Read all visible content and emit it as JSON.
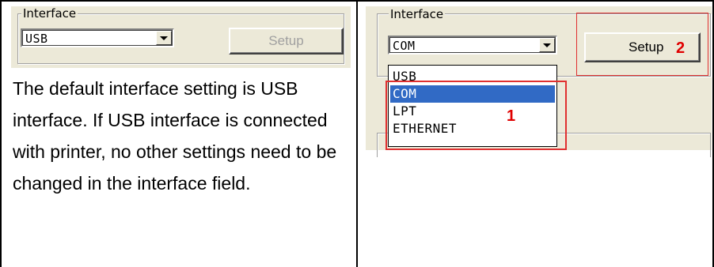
{
  "left": {
    "group_label": "Interface",
    "combo_value": "USB",
    "setup_label": "Setup",
    "description": "The default interface setting is USB interface. If USB interface is connected with printer, no other settings need to be changed in the interface field."
  },
  "right": {
    "group_label": "Interface",
    "combo_value": "COM",
    "setup_label": "Setup",
    "options": [
      "USB",
      "COM",
      "LPT",
      "ETHERNET"
    ],
    "selected_index": 1,
    "marker_1": "1",
    "marker_2": "2"
  },
  "colors": {
    "dialog_bg": "#ece9d8",
    "selection": "#316ac5",
    "highlight_red": "#e03030"
  }
}
